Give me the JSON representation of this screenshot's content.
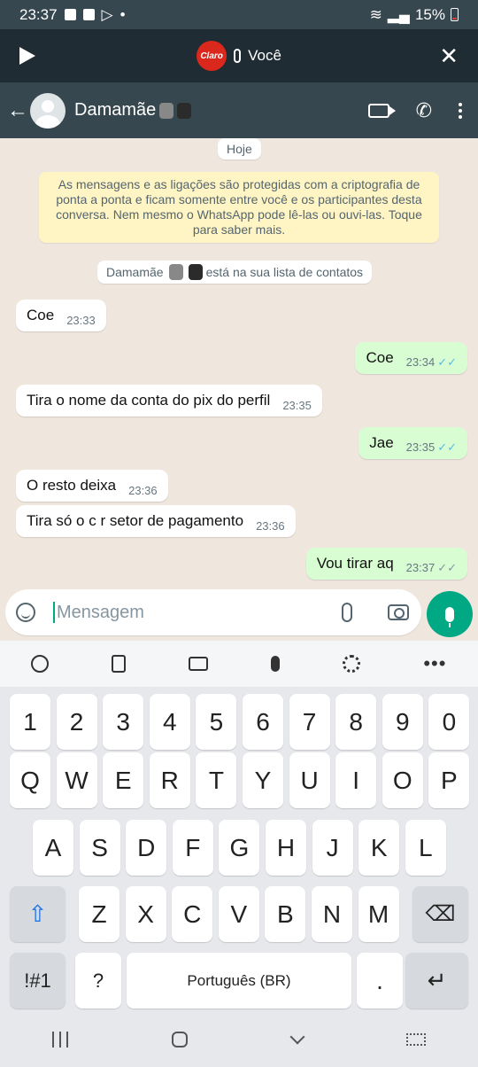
{
  "status": {
    "time": "23:37",
    "battery": "15%"
  },
  "call": {
    "carrier": "Claro",
    "label": "Você"
  },
  "header": {
    "contact": "Damamãe"
  },
  "chat": {
    "date_chip": "Hoje",
    "encryption": "As mensagens e as ligações são protegidas com a criptografia de ponta a ponta e ficam somente entre você e os participantes desta conversa. Nem mesmo o WhatsApp pode lê-las ou ouvi-las. Toque para saber mais.",
    "contact_notice_name": "Damamãe",
    "contact_notice": "está na sua lista de contatos",
    "messages": [
      {
        "text": "Coe",
        "time": "23:33"
      },
      {
        "text": "Coe",
        "time": "23:34"
      },
      {
        "text": "Tira o nome da conta do pix do perfil",
        "time": "23:35"
      },
      {
        "text": "Jae",
        "time": "23:35"
      },
      {
        "text": "O resto deixa",
        "time": "23:36"
      },
      {
        "text": "Tira só o c r setor de pagamento",
        "time": "23:36"
      },
      {
        "text": "Vou tirar aq",
        "time": "23:37"
      }
    ]
  },
  "input": {
    "placeholder": "Mensagem"
  },
  "keyboard": {
    "row1": [
      "1",
      "2",
      "3",
      "4",
      "5",
      "6",
      "7",
      "8",
      "9",
      "0"
    ],
    "row2": [
      "Q",
      "W",
      "E",
      "R",
      "T",
      "Y",
      "U",
      "I",
      "O",
      "P"
    ],
    "row3": [
      "A",
      "S",
      "D",
      "F",
      "G",
      "H",
      "J",
      "K",
      "L"
    ],
    "row4": [
      "Z",
      "X",
      "C",
      "V",
      "B",
      "N",
      "M"
    ],
    "symbols": "!#1",
    "question": "?",
    "space": "Português (BR)",
    "period": "."
  },
  "colors": {
    "header": "#37474f",
    "accent": "#00a884",
    "outgoing": "#d9fdd3",
    "incoming": "#ffffff"
  }
}
